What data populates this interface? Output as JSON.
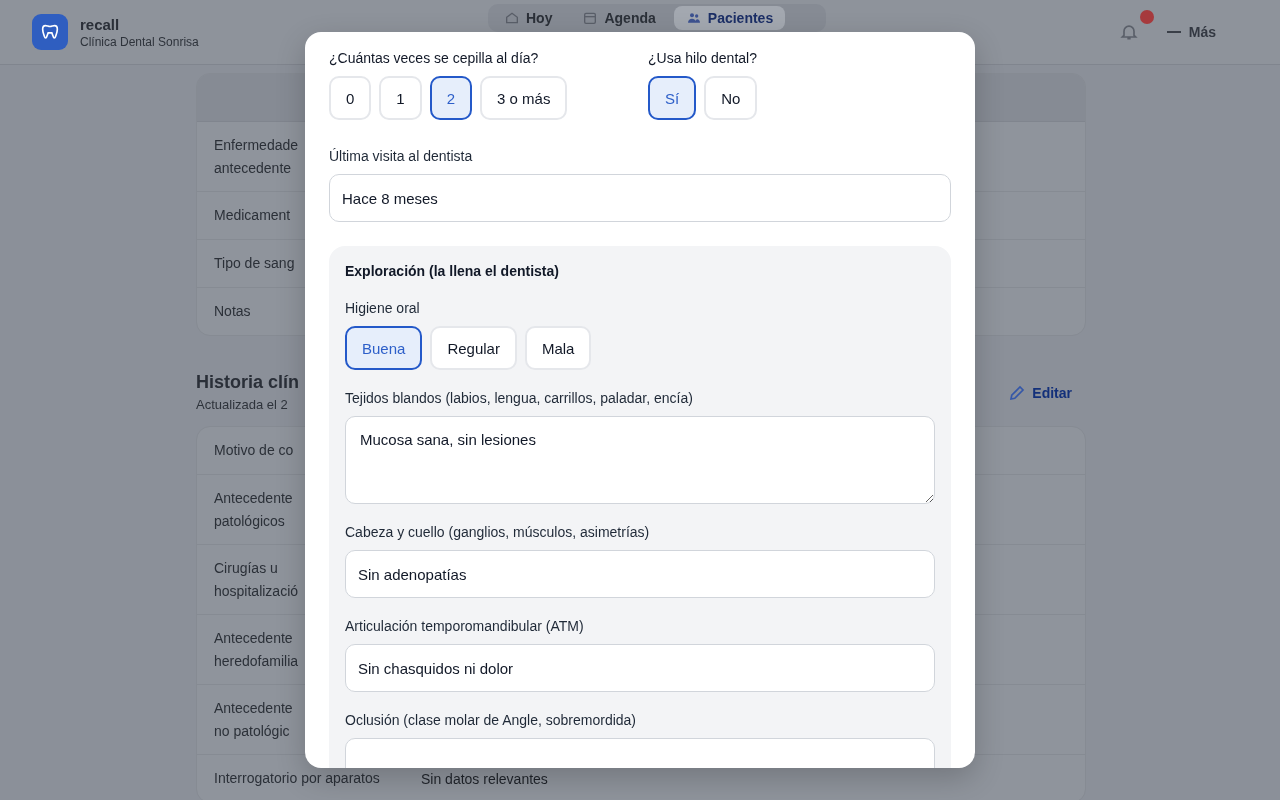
{
  "header": {
    "app_name": "recall",
    "clinic": "Clínica Dental Sonrisa",
    "nav": [
      {
        "label": "Hoy",
        "selected": false
      },
      {
        "label": "Agenda",
        "selected": false
      },
      {
        "label": "Pacientes",
        "selected": true
      }
    ],
    "more": "Más"
  },
  "patient_card": {
    "rows": [
      {
        "label": "Enfermedade\nantecedente"
      },
      {
        "label": "Medicament"
      },
      {
        "label": "Tipo de sang"
      },
      {
        "label": "Notas"
      }
    ]
  },
  "history": {
    "title": "Historia clín",
    "updated": "Actualizada el 2",
    "edit": "Editar",
    "rows": [
      {
        "label": "Motivo de co"
      },
      {
        "label": "Antecedente\npatológicos"
      },
      {
        "label": "Cirugías u\nhospitalizació"
      },
      {
        "label": "Antecedente\nheredofamilia"
      },
      {
        "label": "Antecedente\nno patológic"
      },
      {
        "label": "Interrogatorio por aparatos",
        "value": "Sin datos relevantes"
      }
    ]
  },
  "modal": {
    "questions": [
      {
        "label": "¿Cuántas veces se cepilla al día?",
        "options": [
          {
            "label": "0",
            "selected": false
          },
          {
            "label": "1",
            "selected": false
          },
          {
            "label": "2",
            "selected": true
          },
          {
            "label": "3 o más",
            "selected": false
          }
        ]
      },
      {
        "label": "¿Usa hilo dental?",
        "options": [
          {
            "label": "Sí",
            "selected": true
          },
          {
            "label": "No",
            "selected": false
          }
        ]
      }
    ],
    "last_visit": {
      "label": "Última visita al dentista",
      "value": "Hace 8 meses"
    },
    "exam": {
      "title": "Exploración (la llena el dentista)",
      "hygiene": {
        "label": "Higiene oral",
        "options": [
          {
            "label": "Buena",
            "selected": true
          },
          {
            "label": "Regular",
            "selected": false
          },
          {
            "label": "Mala",
            "selected": false
          }
        ]
      },
      "fields": [
        {
          "kind": "textarea",
          "label": "Tejidos blandos (labios, lengua, carrillos, paladar, encía)",
          "value": "Mucosa sana, sin lesiones"
        },
        {
          "kind": "input",
          "label": "Cabeza y cuello (ganglios, músculos, asimetrías)",
          "value": "Sin adenopatías"
        },
        {
          "kind": "input",
          "label": "Articulación temporomandibular (ATM)",
          "value": "Sin chasquidos ni dolor"
        },
        {
          "kind": "input",
          "label": "Oclusión (clase molar de Angle, sobremordida)"
        }
      ]
    }
  }
}
